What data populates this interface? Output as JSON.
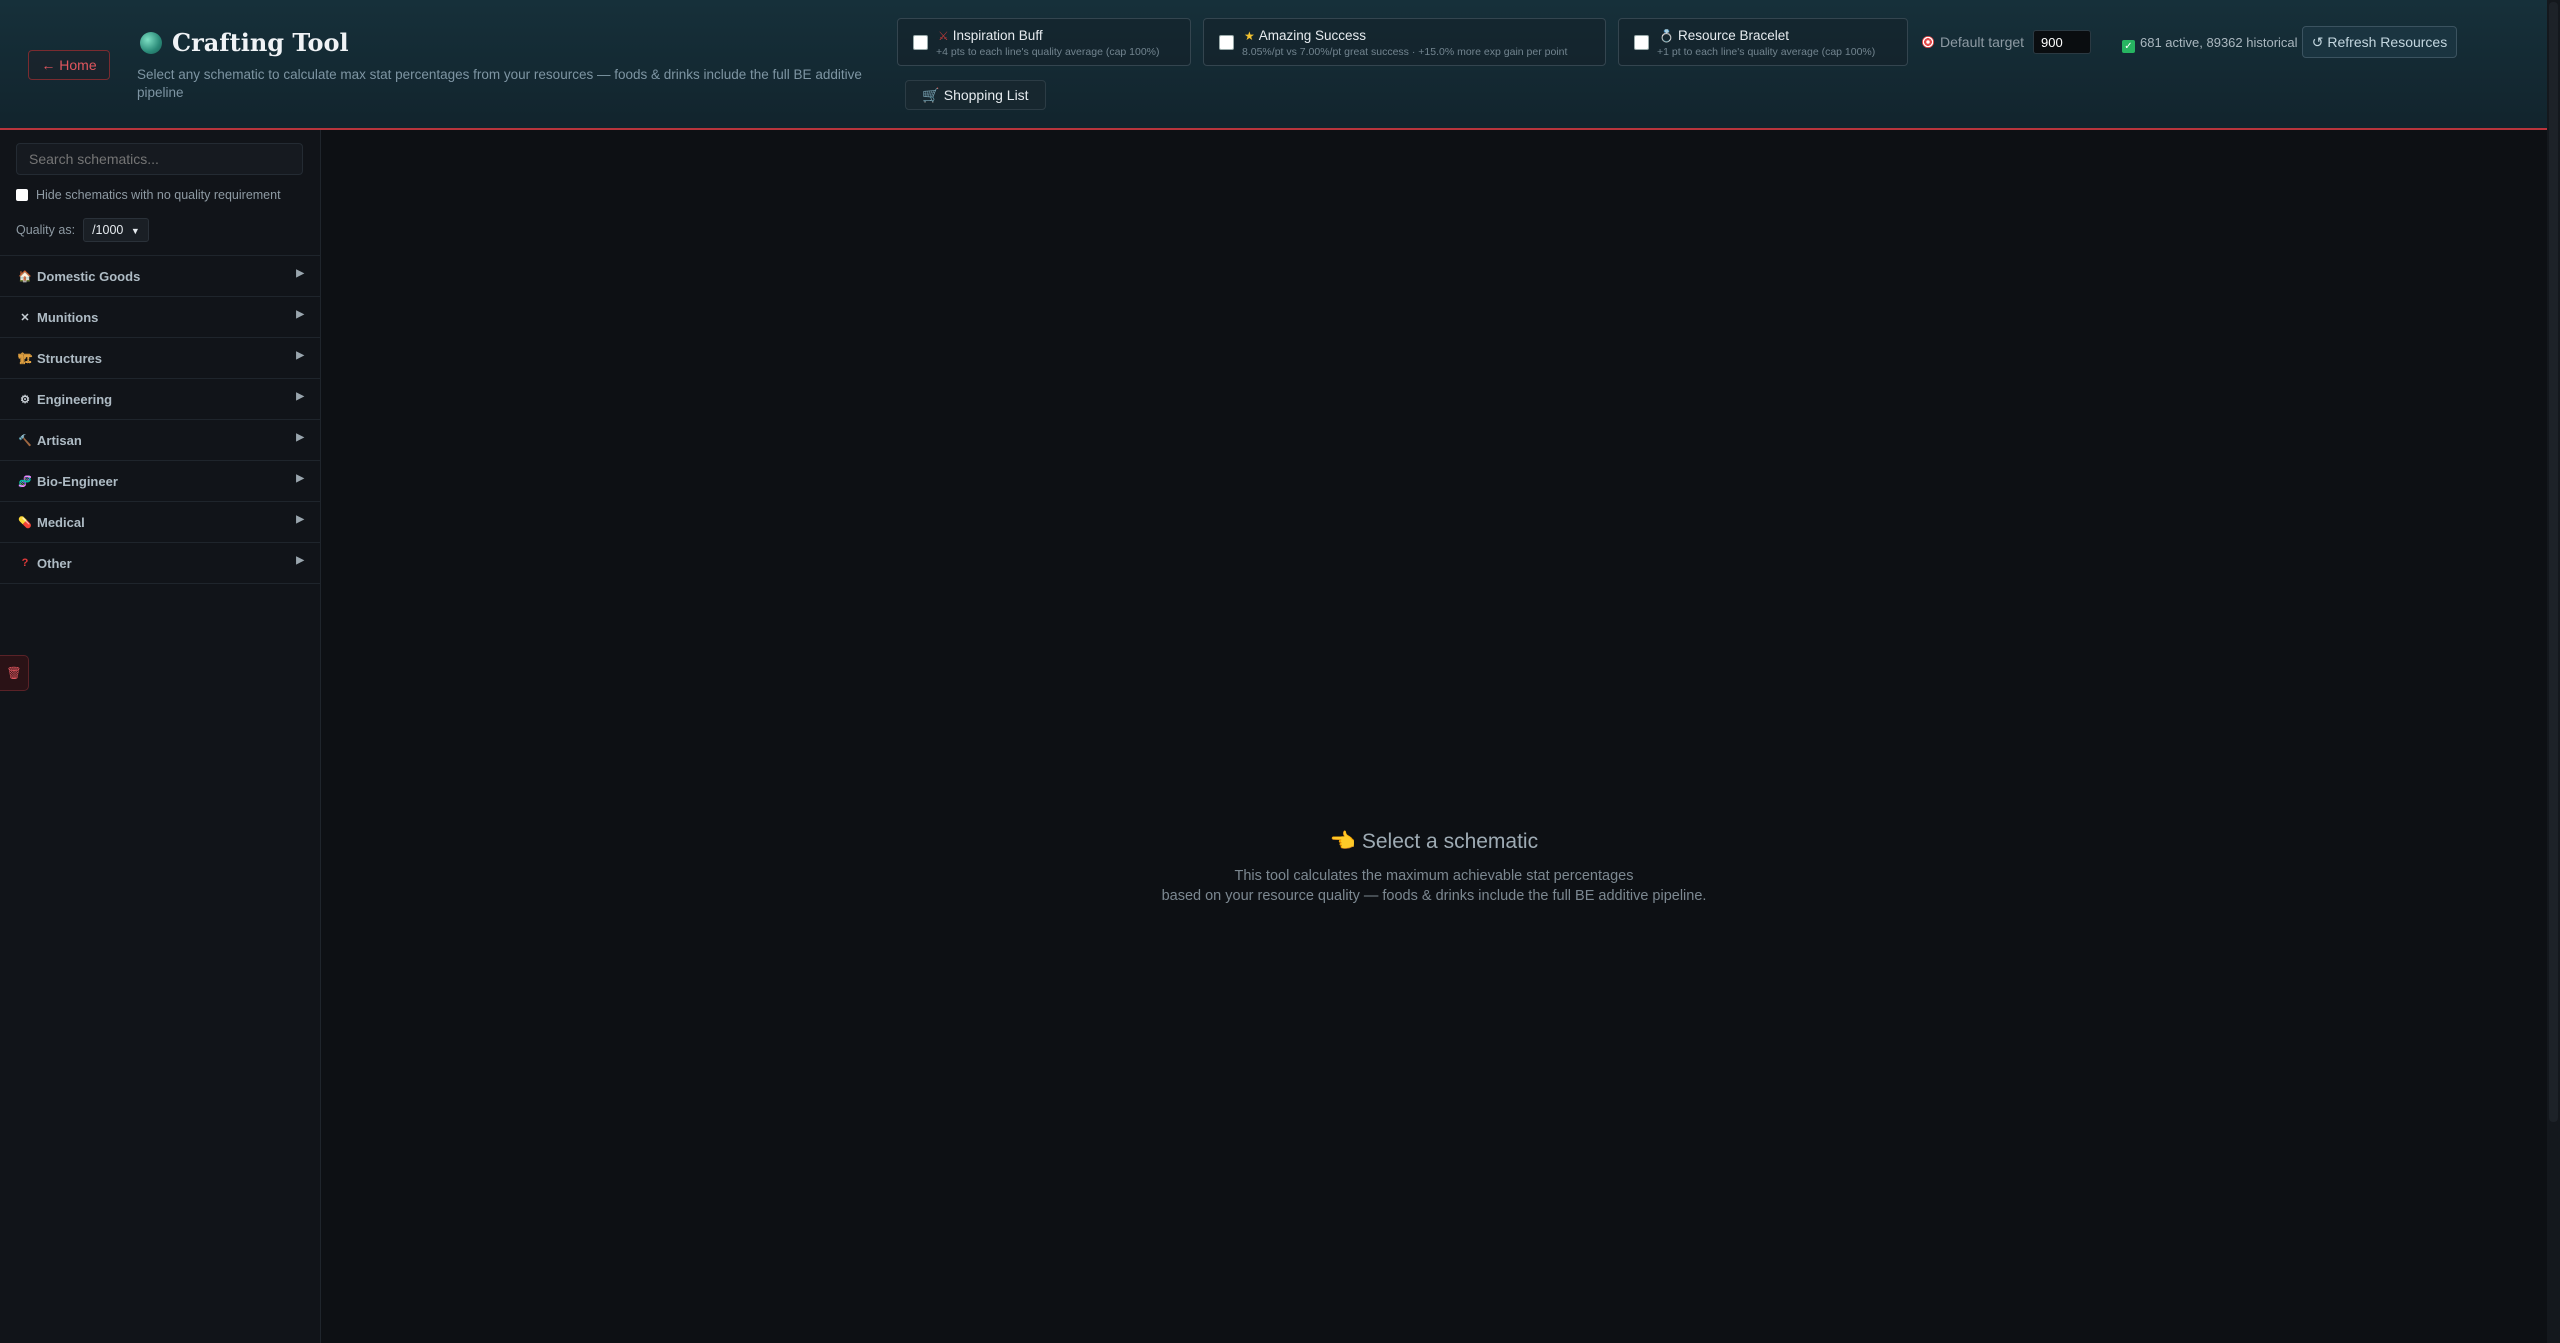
{
  "header": {
    "home_label": "← Home",
    "title": "Crafting Tool",
    "subtitle": "Select any schematic to calculate max stat percentages from your resources — foods & drinks include the full BE additive pipeline",
    "toggles": [
      {
        "icon": "⚔",
        "name": "Inspiration Buff",
        "desc": "+4 pts to each line's quality average (cap 100%)",
        "checked": false
      },
      {
        "icon": "★",
        "name": "Amazing Success",
        "desc": "8.05%/pt vs 7.00%/pt great success · +15.0% more exp gain per point",
        "checked": false
      },
      {
        "icon": "💍",
        "name": "Resource Bracelet",
        "desc": "+1 pt to each line's quality average (cap 100%)",
        "checked": false
      }
    ],
    "default_target_label": "Default target",
    "default_target_value": "900",
    "status_text": "681 active, 89362 historical",
    "refresh_label": "↺ Refresh Resources",
    "shopping_label": "🛒 Shopping List"
  },
  "sidebar": {
    "search_placeholder": "Search schematics...",
    "hide_label": "Hide schematics with no quality requirement",
    "quality_label": "Quality as:",
    "quality_value": "/1000",
    "categories": [
      {
        "icon": "🏠",
        "label": "Domestic Goods"
      },
      {
        "icon": "✕",
        "label": "Munitions"
      },
      {
        "icon": "🏗",
        "label": "Structures"
      },
      {
        "icon": "⚙",
        "label": "Engineering"
      },
      {
        "icon": "🔨",
        "label": "Artisan"
      },
      {
        "icon": "🧬",
        "label": "Bio-Engineer"
      },
      {
        "icon": "💊",
        "label": "Medical"
      },
      {
        "icon": "?",
        "label": "Other"
      }
    ],
    "side_tab_icon": "🗑"
  },
  "main": {
    "empty_title": "👈 Select a schematic",
    "empty_line1": "This tool calculates the maximum achievable stat percentages",
    "empty_line2": "based on your resource quality — foods & drinks include the full BE additive pipeline."
  },
  "colors": {
    "accent_red": "#b8343c",
    "check_green": "#27b561"
  }
}
